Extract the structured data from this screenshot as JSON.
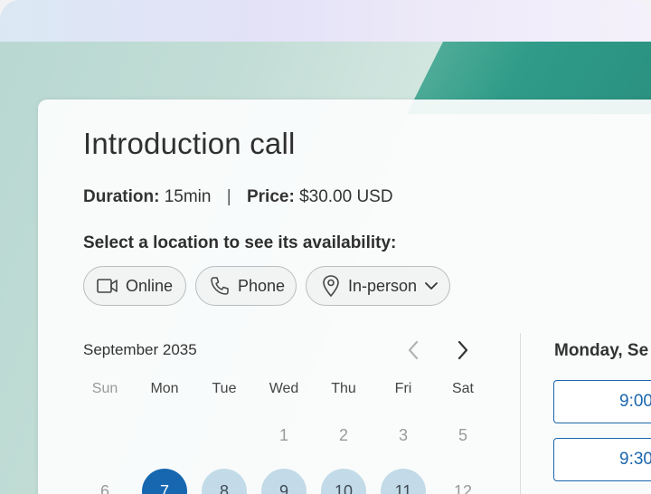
{
  "booking": {
    "title": "Introduction call",
    "duration_label": "Duration:",
    "duration_value": "15min",
    "separator": "|",
    "price_label": "Price:",
    "price_value": "$30.00 USD",
    "location_prompt": "Select a location to see its availability:"
  },
  "locations": [
    {
      "label": "Online",
      "icon": "video-camera-icon"
    },
    {
      "label": "Phone",
      "icon": "phone-icon"
    },
    {
      "label": "In-person",
      "icon": "map-pin-icon"
    }
  ],
  "calendar": {
    "month_label": "September 2035",
    "weekdays": [
      "Sun",
      "Mon",
      "Tue",
      "Wed",
      "Thu",
      "Fri",
      "Sat"
    ],
    "week1": [
      "1",
      "2",
      "3",
      "5"
    ],
    "week2": [
      "6",
      "7",
      "8",
      "9",
      "10",
      "11",
      "12"
    ]
  },
  "slots": {
    "day_heading": "Monday, Se",
    "times": [
      "9:00",
      "9:30"
    ]
  },
  "colors": {
    "accent": "#1667b0",
    "available": "#c3dbe8"
  }
}
